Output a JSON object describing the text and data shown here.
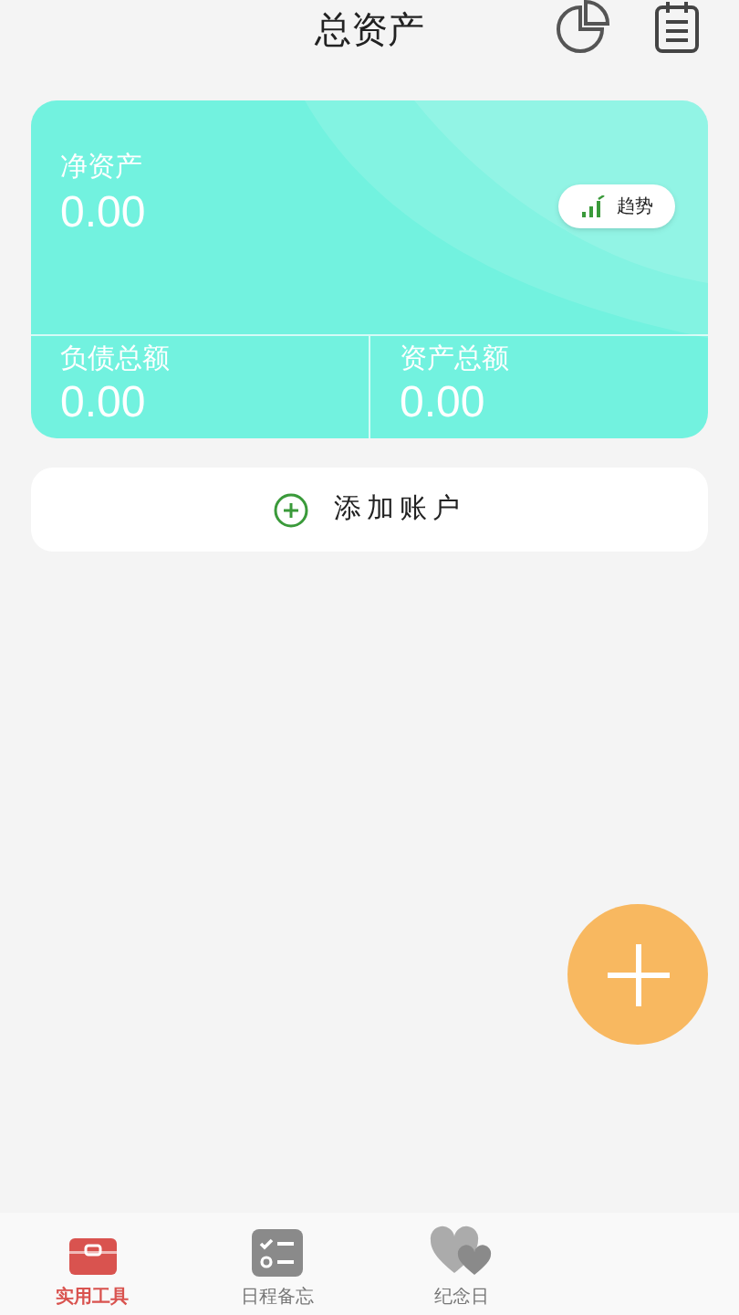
{
  "header": {
    "title": "总资产"
  },
  "summary_card": {
    "net_label": "净资产",
    "net_value": "0.00",
    "trend_button": "趋势",
    "liabilities_label": "负债总额",
    "liabilities_value": "0.00",
    "assets_label": "资产总额",
    "assets_value": "0.00"
  },
  "add_account_button": "添加账户",
  "bottom_nav": [
    {
      "label": "实用工具",
      "kind": "toolbox",
      "selected": true
    },
    {
      "label": "日程备忘",
      "kind": "checklist",
      "selected": false
    },
    {
      "label": "纪念日",
      "kind": "hearts",
      "selected": false
    }
  ]
}
